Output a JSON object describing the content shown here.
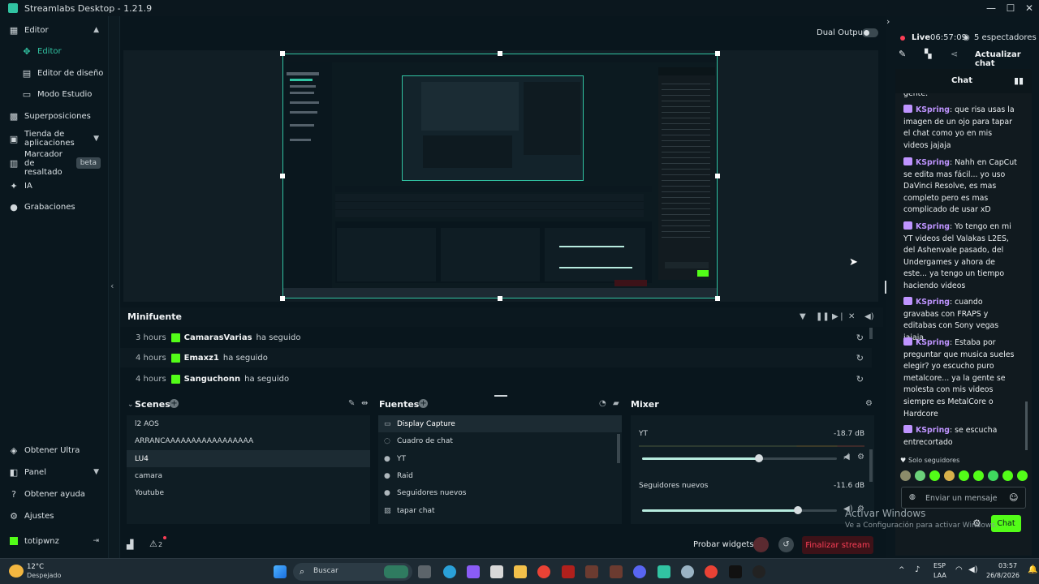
{
  "window": {
    "title": "Streamlabs Desktop - 1.21.9",
    "minimize": "—",
    "maximize": "☐",
    "close": "✕"
  },
  "sidebar": {
    "items": [
      {
        "label": "Editor",
        "icon": "layout-icon"
      },
      {
        "label": "Editor",
        "icon": "editor-icon",
        "active": true
      },
      {
        "label": "Editor de diseño",
        "icon": "layout-editor-icon"
      },
      {
        "label": "Modo Estudio",
        "icon": "studio-icon"
      },
      {
        "label": "Superposiciones",
        "icon": "overlays-icon"
      },
      {
        "label": "Tienda de aplicaciones",
        "icon": "store-icon"
      },
      {
        "label": "Marcador de resaltado",
        "icon": "highlighter-icon",
        "badge": "beta"
      },
      {
        "label": "IA",
        "icon": "ai-icon"
      },
      {
        "label": "Grabaciones",
        "icon": "recordings-icon"
      }
    ],
    "bottom": [
      {
        "label": "Obtener Ultra",
        "icon": "ultra-icon"
      },
      {
        "label": "Panel",
        "icon": "panel-icon"
      },
      {
        "label": "Obtener ayuda",
        "icon": "help-icon"
      },
      {
        "label": "Ajustes",
        "icon": "settings-icon"
      },
      {
        "label": "totipwnz",
        "icon": "kick-icon"
      }
    ]
  },
  "preview": {
    "dual_output_label": "Dual Output",
    "dual_output_enabled": false
  },
  "minifuente": {
    "title": "Minifuente",
    "rows": [
      {
        "time": "3 hours",
        "user": "CamarasVarias",
        "action": "ha seguido"
      },
      {
        "time": "4 hours",
        "user": "Emaxz1",
        "action": "ha seguido"
      },
      {
        "time": "4 hours",
        "user": "Sanguchonn",
        "action": "ha seguido"
      }
    ]
  },
  "scenes": {
    "title": "Scenes",
    "items": [
      "l2 AOS",
      "ARRANCAAAAAAAAAAAAAAAAA",
      "LU4",
      "camara",
      "Youtube"
    ],
    "selected_index": 2
  },
  "sources": {
    "title": "Fuentes",
    "items": [
      {
        "label": "Display Capture",
        "icon": "monitor-icon"
      },
      {
        "label": "Cuadro de chat",
        "icon": "chat-box-icon"
      },
      {
        "label": "YT",
        "icon": "user-icon"
      },
      {
        "label": "Raid",
        "icon": "user-icon"
      },
      {
        "label": "Seguidores nuevos",
        "icon": "user-icon"
      },
      {
        "label": "tapar chat",
        "icon": "image-icon"
      }
    ],
    "selected_index": 0
  },
  "mixer": {
    "title": "Mixer",
    "channels": [
      {
        "name": "YT",
        "db": "-18.7 dB",
        "level": 0.6
      },
      {
        "name": "Seguidores nuevos",
        "db": "-11.6 dB",
        "level": 0.8
      }
    ]
  },
  "footer": {
    "test_widgets": "Probar widgets",
    "end_stream": "Finalizar stream",
    "alert_count": "2"
  },
  "chat_header": {
    "live_label": "Live",
    "live_time": "06:57:09",
    "viewers": "5 espectadores",
    "update_label": "Actualizar chat"
  },
  "chat": {
    "tab_title": "Chat",
    "partial_top": "gente.",
    "messages": [
      {
        "user": "KSpring",
        "text": ": que risa usas la imagen de un ojo para tapar el chat como yo en mis videos jajaja"
      },
      {
        "user": "KSpring",
        "text": ": Nahh en CapCut se edita mas fácil... yo uso DaVinci Resolve, es mas completo pero es mas complicado de usar xD"
      },
      {
        "user": "KSpring",
        "text": ": Yo tengo en mi YT videos del Valakas L2ES, del Ashenvale pasado, del Undergames y ahora de este... ya tengo un tiempo haciendo videos"
      },
      {
        "user": "KSpring",
        "text": ": cuando gravabas con FRAPS y editabas con Sony vegas jajaja"
      },
      {
        "user": "KSpring",
        "text": ": Estaba por preguntar que musica sueles elegir? yo escucho puro metalcore... ya la gente se molesta con mis videos siempre es MetalCore o Hardcore"
      },
      {
        "user": "KSpring",
        "text": ": se escucha entrecortado"
      }
    ],
    "followers_only": "Solo seguidores",
    "input_placeholder": "Enviar un mensaje",
    "send_label": "Chat"
  },
  "watermark": {
    "line1": "Activar Windows",
    "line2": "Ve a Configuración para activar Windows."
  },
  "taskbar": {
    "weather_temp": "12°C",
    "weather_desc": "Despejado",
    "search_placeholder": "Buscar",
    "lang_line1": "ESP",
    "lang_line2": "LAA",
    "time": "03:57",
    "date": "26/8/2026"
  },
  "colors": {
    "accent": "#31c3a2",
    "kick": "#53fc18",
    "live": "#fc3e56",
    "chat_name": "#bf94ff"
  }
}
